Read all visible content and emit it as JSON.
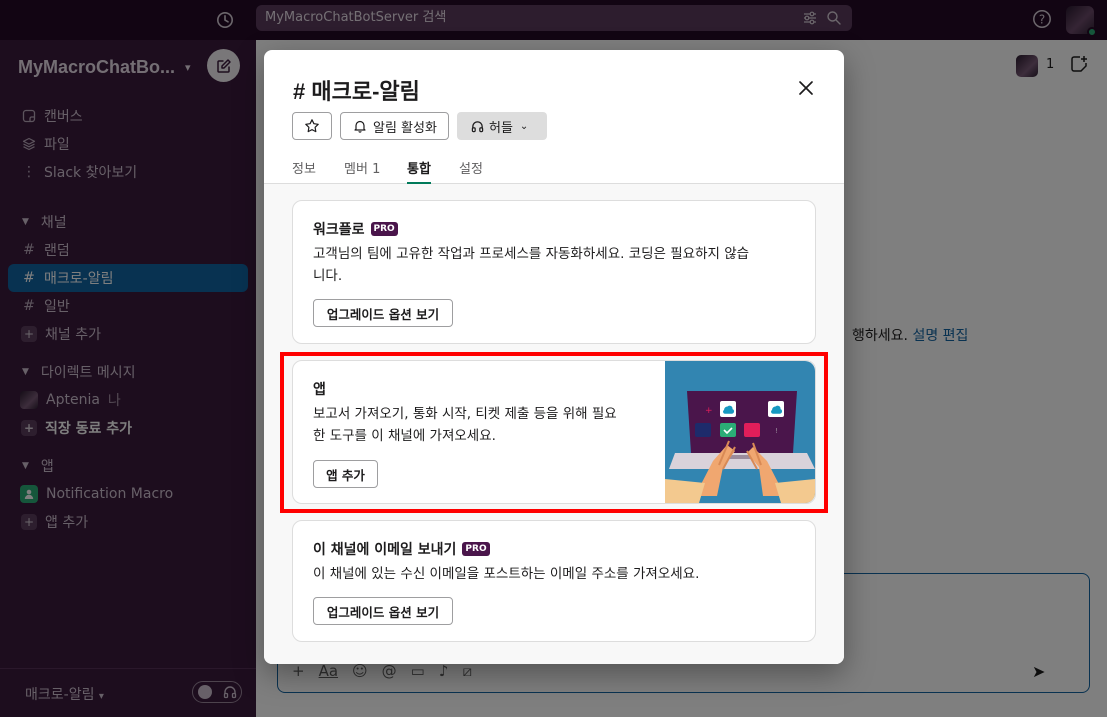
{
  "topbar": {
    "search_placeholder": "MyMacroChatBotServer 검색"
  },
  "sidebar": {
    "workspace_name": "MyMacroChatBo...",
    "nav": [
      {
        "label": "캔버스",
        "icon": "canvas-icon"
      },
      {
        "label": "파일",
        "icon": "files-icon"
      },
      {
        "label": "Slack 찾아보기",
        "icon": "more-vertical-icon"
      }
    ],
    "channels_section": "채널",
    "channels": [
      {
        "label": "랜덤",
        "active": false
      },
      {
        "label": "매크로-알림",
        "active": true
      },
      {
        "label": "일반",
        "active": false
      }
    ],
    "add_channel": "채널 추가",
    "dm_section": "다이렉트 메시지",
    "dm_user": "Aptenia",
    "dm_user_suffix": "나",
    "add_coworker": "직장 동료 추가",
    "apps_section": "앱",
    "app_item": "Notification Macro",
    "add_app": "앱 추가",
    "footer_channel": "매크로-알림"
  },
  "main": {
    "member_count": "1",
    "bg_text": "행하세요.",
    "bg_link": "설명 편집"
  },
  "modal": {
    "title": "# 매크로-알림",
    "notify_label": "알림 활성화",
    "huddle_label": "허들",
    "tabs": {
      "info": "정보",
      "members": "멤버",
      "members_count": "1",
      "integrations": "통합",
      "settings": "설정"
    },
    "active_tab": "통합",
    "cards": {
      "workflow": {
        "title": "워크플로",
        "badge": "PRO",
        "desc_line1": "고객님의 팀에 고유한 작업과 프로세스를 자동화하세요. 코딩은 필요하지 않습",
        "desc_line2": "니다.",
        "button": "업그레이드 옵션 보기"
      },
      "apps": {
        "title": "앱",
        "desc_line1": "보고서 가져오기, 통화 시작, 티켓 제출 등을 위해 필요",
        "desc_line2": "한 도구를 이 채널에 가져오세요.",
        "button": "앱 추가"
      },
      "email": {
        "title": "이 채널에 이메일 보내기",
        "badge": "PRO",
        "desc": "이 채널에 있는 수신 이메일을 포스트하는 이메일 주소를 가져오세요.",
        "button": "업그레이드 옵션 보기"
      }
    }
  },
  "colors": {
    "sidebar_bg": "#3b1a3d",
    "topbar_bg": "#250a27",
    "active_channel": "#1164a3",
    "pro_badge": "#4a154b",
    "tab_underline": "#007a5a",
    "highlight_box": "#ff0000"
  }
}
